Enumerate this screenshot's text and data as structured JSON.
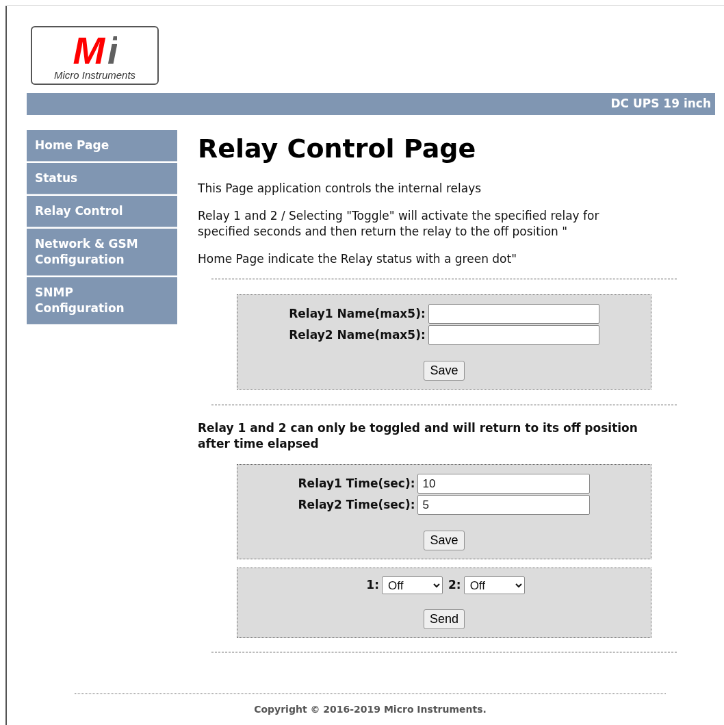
{
  "logo": {
    "mark_primary": "M",
    "mark_secondary": "i",
    "name": "Micro Instruments"
  },
  "header": {
    "title": "DC UPS 19 inch"
  },
  "sidebar": {
    "items": [
      {
        "label": "Home Page"
      },
      {
        "label": "Status"
      },
      {
        "label": "Relay Control"
      },
      {
        "label": "Network & GSM Configuration"
      },
      {
        "label": "SNMP Configuration"
      }
    ]
  },
  "page": {
    "title": "Relay Control Page",
    "paragraphs": [
      "This Page application controls the internal relays",
      "Relay 1 and 2 / Selecting \"Toggle\" will activate the specified relay for specified seconds and then return the relay to the off position \"",
      "Home Page indicate the Relay status with a green dot\""
    ]
  },
  "names_form": {
    "fields": [
      {
        "label": "Relay1 Name(max5):"
      },
      {
        "label": "Relay2 Name(max5):"
      }
    ],
    "button": "Save"
  },
  "toggle_note": "Relay 1 and 2 can only be toggled and will return to its off position after time elapsed",
  "time_form": {
    "fields": [
      {
        "label": "Relay1 Time(sec):",
        "value": "10"
      },
      {
        "label": "Relay2 Time(sec):",
        "value": "5"
      }
    ],
    "button": "Save"
  },
  "send_form": {
    "selects": [
      {
        "label": "1:",
        "value": "Off"
      },
      {
        "label": "2:",
        "value": "Off"
      }
    ],
    "button": "Send"
  },
  "footer": {
    "copyright": "Copyright © 2016-2019 Micro Instruments."
  }
}
